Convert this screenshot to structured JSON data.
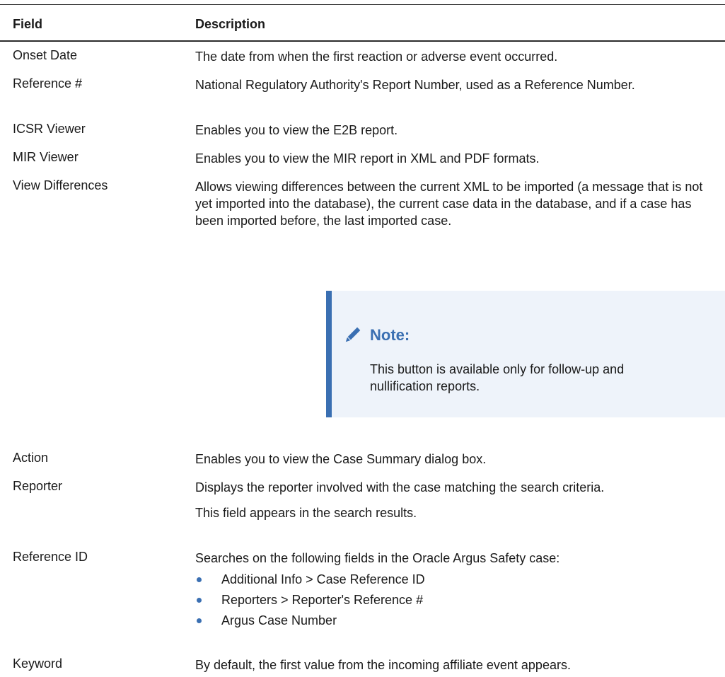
{
  "table": {
    "headers": {
      "field": "Field",
      "description": "Description"
    },
    "rows": [
      {
        "field": "Onset Date",
        "paragraphs": [
          "The date from when the first reaction or adverse event occurred."
        ]
      },
      {
        "field": "Reference #",
        "paragraphs": [
          "National Regulatory Authority's Report Number, used as a Reference Number."
        ]
      },
      {
        "field": "ICSR Viewer",
        "paragraphs": [
          "Enables you to view the E2B report."
        ]
      },
      {
        "field": "MIR Viewer",
        "paragraphs": [
          "Enables you to view the MIR report in XML and PDF formats."
        ]
      },
      {
        "field": "View Differences",
        "paragraphs": [
          "Allows viewing differences between the current XML to be imported (a message that is not yet imported into the database), the current case data in the database, and if a case has been imported before, the last imported case."
        ]
      },
      {
        "field": "Action",
        "paragraphs": [
          "Enables you to view the Case Summary dialog box."
        ]
      },
      {
        "field": "Reporter",
        "paragraphs": [
          "Displays the reporter involved with the case matching the search criteria.",
          "This field appears in the search results."
        ]
      },
      {
        "field": "Reference ID",
        "paragraphs": [
          "Searches on the following fields in the Oracle Argus Safety case:"
        ],
        "bullets": [
          "Additional Info > Case Reference ID",
          "Reporters > Reporter's Reference #",
          "Argus Case Number"
        ]
      },
      {
        "field": "Keyword",
        "paragraphs": [
          "By default, the first value from the incoming affiliate event appears."
        ]
      }
    ]
  },
  "note": {
    "title": "Note:",
    "text": "This button is available only for follow-up and nullification reports.",
    "icon": "pencil-icon",
    "accent_color": "#3a6fb2",
    "background_color": "#eef3fa"
  }
}
